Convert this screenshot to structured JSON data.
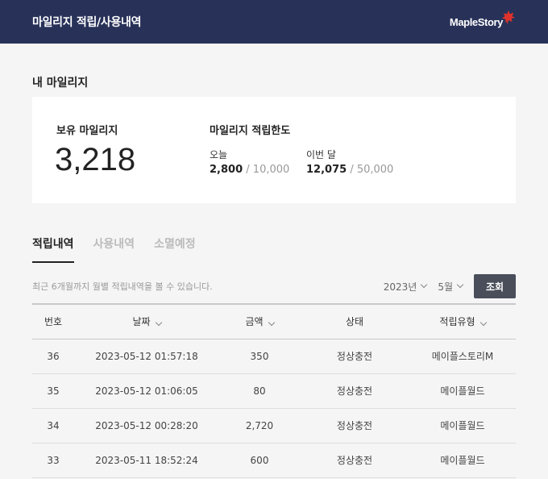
{
  "header": {
    "title": "마일리지 적립/사용내역",
    "logo_text": "MapleStory"
  },
  "my_mileage": {
    "section_title": "내 마일리지",
    "balance_label": "보유 마일리지",
    "balance_value": "3,218",
    "limit_title": "마일리지 적립한도",
    "today": {
      "label": "오늘",
      "current": "2,800",
      "max": "10,000"
    },
    "month": {
      "label": "이번 달",
      "current": "12,075",
      "max": "50,000"
    },
    "limit_separator": "/"
  },
  "tabs": [
    {
      "label": "적립내역",
      "active": true
    },
    {
      "label": "사용내역",
      "active": false
    },
    {
      "label": "소멸예정",
      "active": false
    }
  ],
  "filter": {
    "note": "최근 6개월까지 월별 적립내역을 볼 수 있습니다.",
    "year": "2023년",
    "month": "5월",
    "search_label": "조회"
  },
  "table": {
    "columns": [
      "번호",
      "날짜",
      "금액",
      "상태",
      "적립유형"
    ],
    "rows": [
      {
        "no": "36",
        "date": "2023-05-12 01:57:18",
        "amount": "350",
        "status": "정상충전",
        "type": "메이플스토리M"
      },
      {
        "no": "35",
        "date": "2023-05-12 01:06:05",
        "amount": "80",
        "status": "정상충전",
        "type": "메이플월드"
      },
      {
        "no": "34",
        "date": "2023-05-12 00:28:20",
        "amount": "2,720",
        "status": "정상충전",
        "type": "메이플월드"
      },
      {
        "no": "33",
        "date": "2023-05-11 18:52:24",
        "amount": "600",
        "status": "정상충전",
        "type": "메이플월드"
      }
    ]
  },
  "colors": {
    "header_bg": "#283259",
    "accent_leaf": "#e0322b",
    "search_button": "#4a4e5a"
  }
}
